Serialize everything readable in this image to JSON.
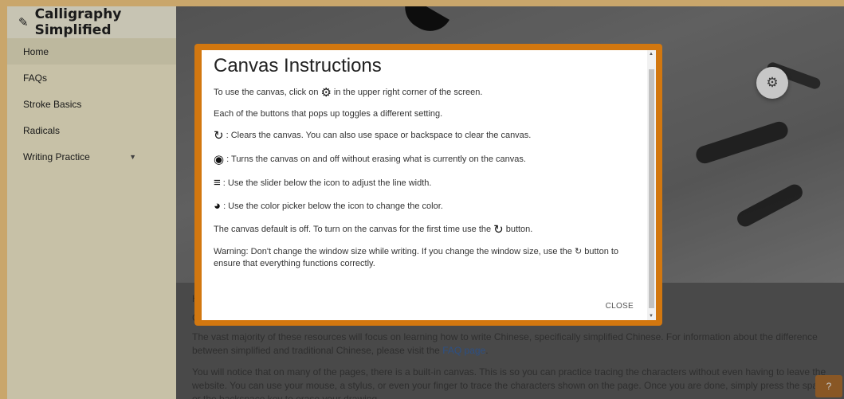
{
  "sidebar": {
    "brand": "Calligraphy Simplified",
    "brand_icon": "brush-icon",
    "items": [
      {
        "label": "Home"
      },
      {
        "label": "FAQs"
      },
      {
        "label": "Stroke Basics"
      },
      {
        "label": "Radicals"
      },
      {
        "label": "Writing Practice",
        "caret": "▼"
      }
    ]
  },
  "main": {
    "fragment_h": "H",
    "fragment_c": "C",
    "paragraph1_a": "The vast majority of these resources will focus on learning how to write Chinese, specifically simplified Chinese. For information about the difference between simplified and traditional Chinese, please visit the ",
    "paragraph1_link": "FAQ page",
    "paragraph1_b": ".",
    "paragraph2": "You will notice that on many of the pages, there is a built-in canvas. This is so you can practice tracing the characters without even having to leave the website. You can use your mouse, a stylus, or even your finger to trace the characters shown on the page. Once you are done, simply press the space or the backspace key to erase your drawing.",
    "help_icon": "?"
  },
  "modal": {
    "title": "Canvas Instructions",
    "line1_a": "To use the canvas, click on",
    "line1_b": "in the upper right corner of the screen.",
    "line2": "Each of the buttons that pops up toggles a different setting.",
    "line3": ": Clears the canvas. You can also use space or backspace to clear the canvas.",
    "line4": ": Turns the canvas on and off without erasing what is currently on the canvas.",
    "line5": ": Use the slider below the icon to adjust the line width.",
    "line6": ": Use the color picker below the icon to change the color.",
    "line7_a": "The canvas default is off. To turn on the canvas for the first time use the",
    "line7_b": "button.",
    "warning_a": "Warning: Don't change the window size while writing. If you change the window size, use the",
    "warning_b": "button to ensure that everything functions correctly.",
    "close": "CLOSE"
  },
  "icons": {
    "gear": "✿",
    "refresh": "↻",
    "eye": "◉",
    "lines": "≡",
    "palette": "◕",
    "brush": "✎"
  }
}
